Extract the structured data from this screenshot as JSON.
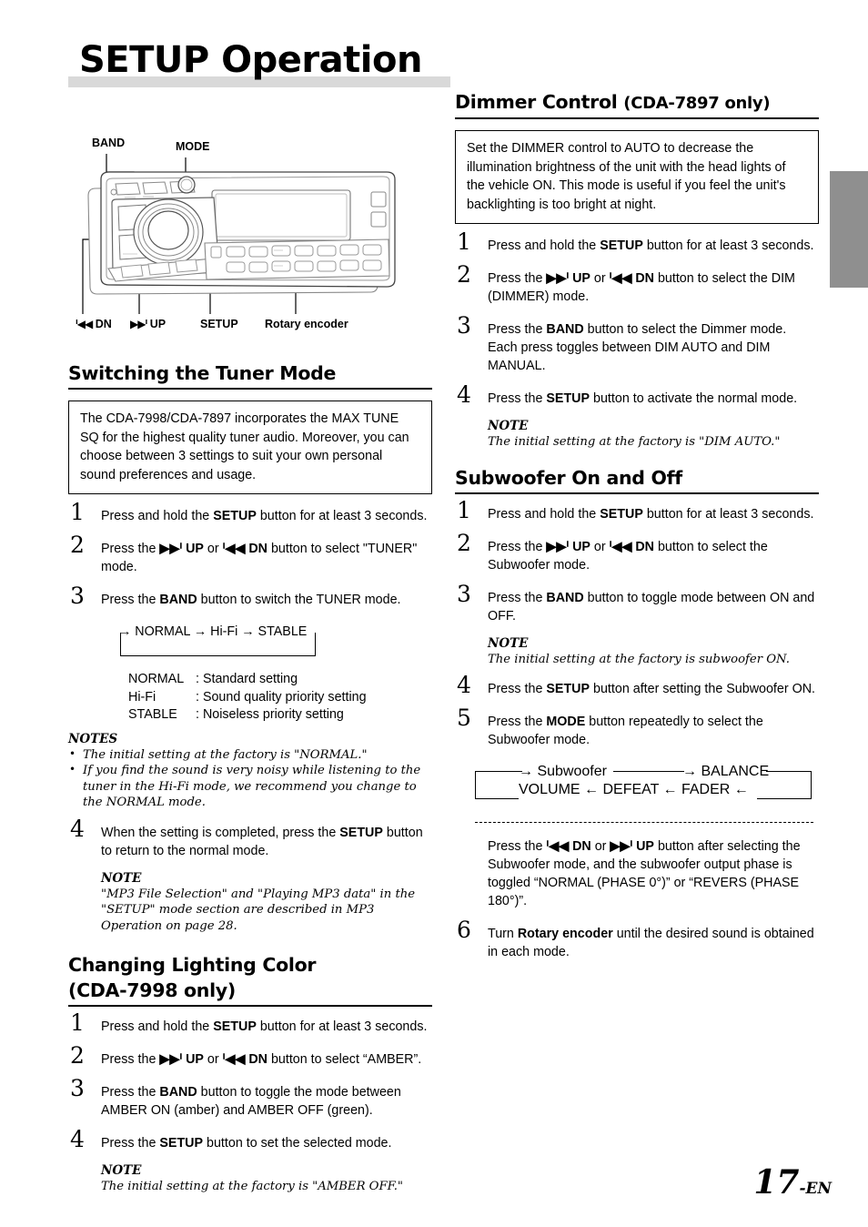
{
  "page": {
    "title": "SETUP Operation",
    "number": "17",
    "number_suffix": "-EN"
  },
  "figure": {
    "labels": {
      "band": "BAND",
      "mode": "MODE",
      "dn": "DN",
      "dn_glyph": "ᑊ◀◀",
      "up": "UP",
      "up_glyph": "▶▶ᑊ",
      "setup": "SETUP",
      "rotary": "Rotary encoder"
    }
  },
  "left_column": {
    "tuner_section": {
      "heading": "Switching the Tuner Mode",
      "intro_box": "The CDA-7998/CDA-7897 incorporates the MAX TUNE SQ for the highest quality tuner audio. Moreover, you can choose between 3 settings to suit your own personal sound preferences and usage.",
      "steps": [
        {
          "num": "1",
          "parts": [
            {
              "t": "Press and hold the ",
              "b": false
            },
            {
              "t": "SETUP",
              "b": true
            },
            {
              "t": " button for at least 3 seconds.",
              "b": false
            }
          ]
        },
        {
          "num": "2",
          "parts": [
            {
              "t": "Press the ",
              "b": false
            },
            {
              "t": "▶▶ᑊ UP",
              "b": true
            },
            {
              "t": " or ",
              "b": false
            },
            {
              "t": "ᑊ◀◀ DN",
              "b": true
            },
            {
              "t": " button to select \"TUNER\" mode.",
              "b": false
            }
          ]
        },
        {
          "num": "3",
          "parts": [
            {
              "t": "Press the ",
              "b": false
            },
            {
              "t": "BAND",
              "b": true
            },
            {
              "t": " button to switch the TUNER mode.",
              "b": false
            }
          ]
        }
      ],
      "cycle": "→ NORMAL → Hi-Fi → STABLE",
      "legend": [
        {
          "key": "NORMAL",
          "value": ": Standard setting"
        },
        {
          "key": "Hi-Fi",
          "value": ": Sound quality priority setting"
        },
        {
          "key": "STABLE",
          "value": ": Noiseless priority setting"
        }
      ],
      "notes_title": "NOTES",
      "notes": [
        "The initial setting at the factory is \"NORMAL.\"",
        "If you find the sound is very noisy while listening to the tuner in the Hi-Fi mode, we recommend you change to the NORMAL mode."
      ],
      "step4": {
        "num": "4",
        "parts": [
          {
            "t": "When the setting is completed, press the ",
            "b": false
          },
          {
            "t": "SETUP",
            "b": true
          },
          {
            "t": " button to return to the normal mode.",
            "b": false
          }
        ]
      },
      "note_title": "NOTE",
      "note_text": "\"MP3 File Selection\" and \"Playing MP3 data\" in the \"SETUP\" mode section are described in  MP3 Operation on page 28."
    },
    "lighting_section": {
      "heading_line1": "Changing Lighting Color",
      "heading_line2": "(CDA-7998 only)",
      "steps": [
        {
          "num": "1",
          "parts": [
            {
              "t": "Press and hold the ",
              "b": false
            },
            {
              "t": "SETUP",
              "b": true
            },
            {
              "t": " button for at least 3 seconds.",
              "b": false
            }
          ]
        },
        {
          "num": "2",
          "parts": [
            {
              "t": "Press the ",
              "b": false
            },
            {
              "t": "▶▶ᑊ UP",
              "b": true
            },
            {
              "t": " or ",
              "b": false
            },
            {
              "t": "ᑊ◀◀ DN",
              "b": true
            },
            {
              "t": " button to select “AMBER”.",
              "b": false
            }
          ]
        },
        {
          "num": "3",
          "parts": [
            {
              "t": "Press the ",
              "b": false
            },
            {
              "t": "BAND",
              "b": true
            },
            {
              "t": " button to toggle the mode between AMBER ON (amber) and AMBER OFF (green).",
              "b": false
            }
          ]
        },
        {
          "num": "4",
          "parts": [
            {
              "t": "Press the ",
              "b": false
            },
            {
              "t": "SETUP",
              "b": true
            },
            {
              "t": " button to set the selected mode.",
              "b": false
            }
          ]
        }
      ],
      "note_title": "NOTE",
      "note_text": "The initial setting at the factory is \"AMBER OFF.\""
    }
  },
  "right_column": {
    "dimmer_section": {
      "heading_main": "Dimmer Control ",
      "heading_small": "(CDA-7897 only)",
      "intro_box": "Set the DIMMER control to AUTO to decrease the illumination brightness of the unit with the head lights of the vehicle ON. This mode is useful if you feel the unit's backlighting is too bright at night.",
      "steps": [
        {
          "num": "1",
          "parts": [
            {
              "t": "Press and hold the ",
              "b": false
            },
            {
              "t": "SETUP",
              "b": true
            },
            {
              "t": " button for at least 3 seconds.",
              "b": false
            }
          ]
        },
        {
          "num": "2",
          "parts": [
            {
              "t": "Press the ",
              "b": false
            },
            {
              "t": "▶▶ᑊ UP",
              "b": true
            },
            {
              "t": " or ",
              "b": false
            },
            {
              "t": "ᑊ◀◀ DN",
              "b": true
            },
            {
              "t": " button to select the DIM (DIMMER) mode.",
              "b": false
            }
          ]
        },
        {
          "num": "3",
          "parts": [
            {
              "t": "Press the ",
              "b": false
            },
            {
              "t": "BAND",
              "b": true
            },
            {
              "t": " button to select the Dimmer mode. Each press toggles between DIM AUTO and DIM MANUAL.",
              "b": false
            }
          ]
        },
        {
          "num": "4",
          "parts": [
            {
              "t": "Press the ",
              "b": false
            },
            {
              "t": "SETUP",
              "b": true
            },
            {
              "t": " button to activate the normal mode.",
              "b": false
            }
          ]
        }
      ],
      "note_title": "NOTE",
      "note_text": "The initial setting at the factory is \"DIM AUTO.\""
    },
    "subwoofer_section": {
      "heading": "Subwoofer On and Off",
      "steps": [
        {
          "num": "1",
          "parts": [
            {
              "t": "Press and hold the ",
              "b": false
            },
            {
              "t": "SETUP",
              "b": true
            },
            {
              "t": " button for at least 3 seconds.",
              "b": false
            }
          ]
        },
        {
          "num": "2",
          "parts": [
            {
              "t": "Press the ",
              "b": false
            },
            {
              "t": "▶▶ᑊ UP",
              "b": true
            },
            {
              "t": " or ",
              "b": false
            },
            {
              "t": "ᑊ◀◀ DN",
              "b": true
            },
            {
              "t": " button to select the Subwoofer mode.",
              "b": false
            }
          ]
        },
        {
          "num": "3",
          "parts": [
            {
              "t": "Press the ",
              "b": false
            },
            {
              "t": "BAND",
              "b": true
            },
            {
              "t": " button to toggle mode between ON and OFF.",
              "b": false
            }
          ]
        }
      ],
      "note_title": "NOTE",
      "note_text": "The initial setting at the factory is subwoofer ON.",
      "step4": {
        "num": "4",
        "parts": [
          {
            "t": "Press the ",
            "b": false
          },
          {
            "t": "SETUP",
            "b": true
          },
          {
            "t": " button after setting the Subwoofer ON.",
            "b": false
          }
        ]
      },
      "step5": {
        "num": "5",
        "parts": [
          {
            "t": "Press the ",
            "b": false
          },
          {
            "t": "MODE",
            "b": true
          },
          {
            "t": " button repeatedly to select the Subwoofer mode.",
            "b": false
          }
        ]
      },
      "cycle_top_a": "→ Subwoofer",
      "cycle_top_b": "→ BALANCE",
      "cycle_bottom": "VOLUME ← DEFEAT ←  FADER ←",
      "phase_para": [
        {
          "t": "Press the ",
          "b": false
        },
        {
          "t": "ᑊ◀◀ DN",
          "b": true
        },
        {
          "t": " or ",
          "b": false
        },
        {
          "t": "▶▶ᑊ UP",
          "b": true
        },
        {
          "t": " button after selecting the Subwoofer mode, and the subwoofer output phase is toggled  “NORMAL (PHASE 0°)” or “REVERS (PHASE 180°)”.",
          "b": false
        }
      ],
      "step6": {
        "num": "6",
        "parts": [
          {
            "t": "Turn ",
            "b": false
          },
          {
            "t": "Rotary encoder",
            "b": true
          },
          {
            "t": " until the desired sound is obtained in each mode.",
            "b": false
          }
        ]
      }
    }
  }
}
